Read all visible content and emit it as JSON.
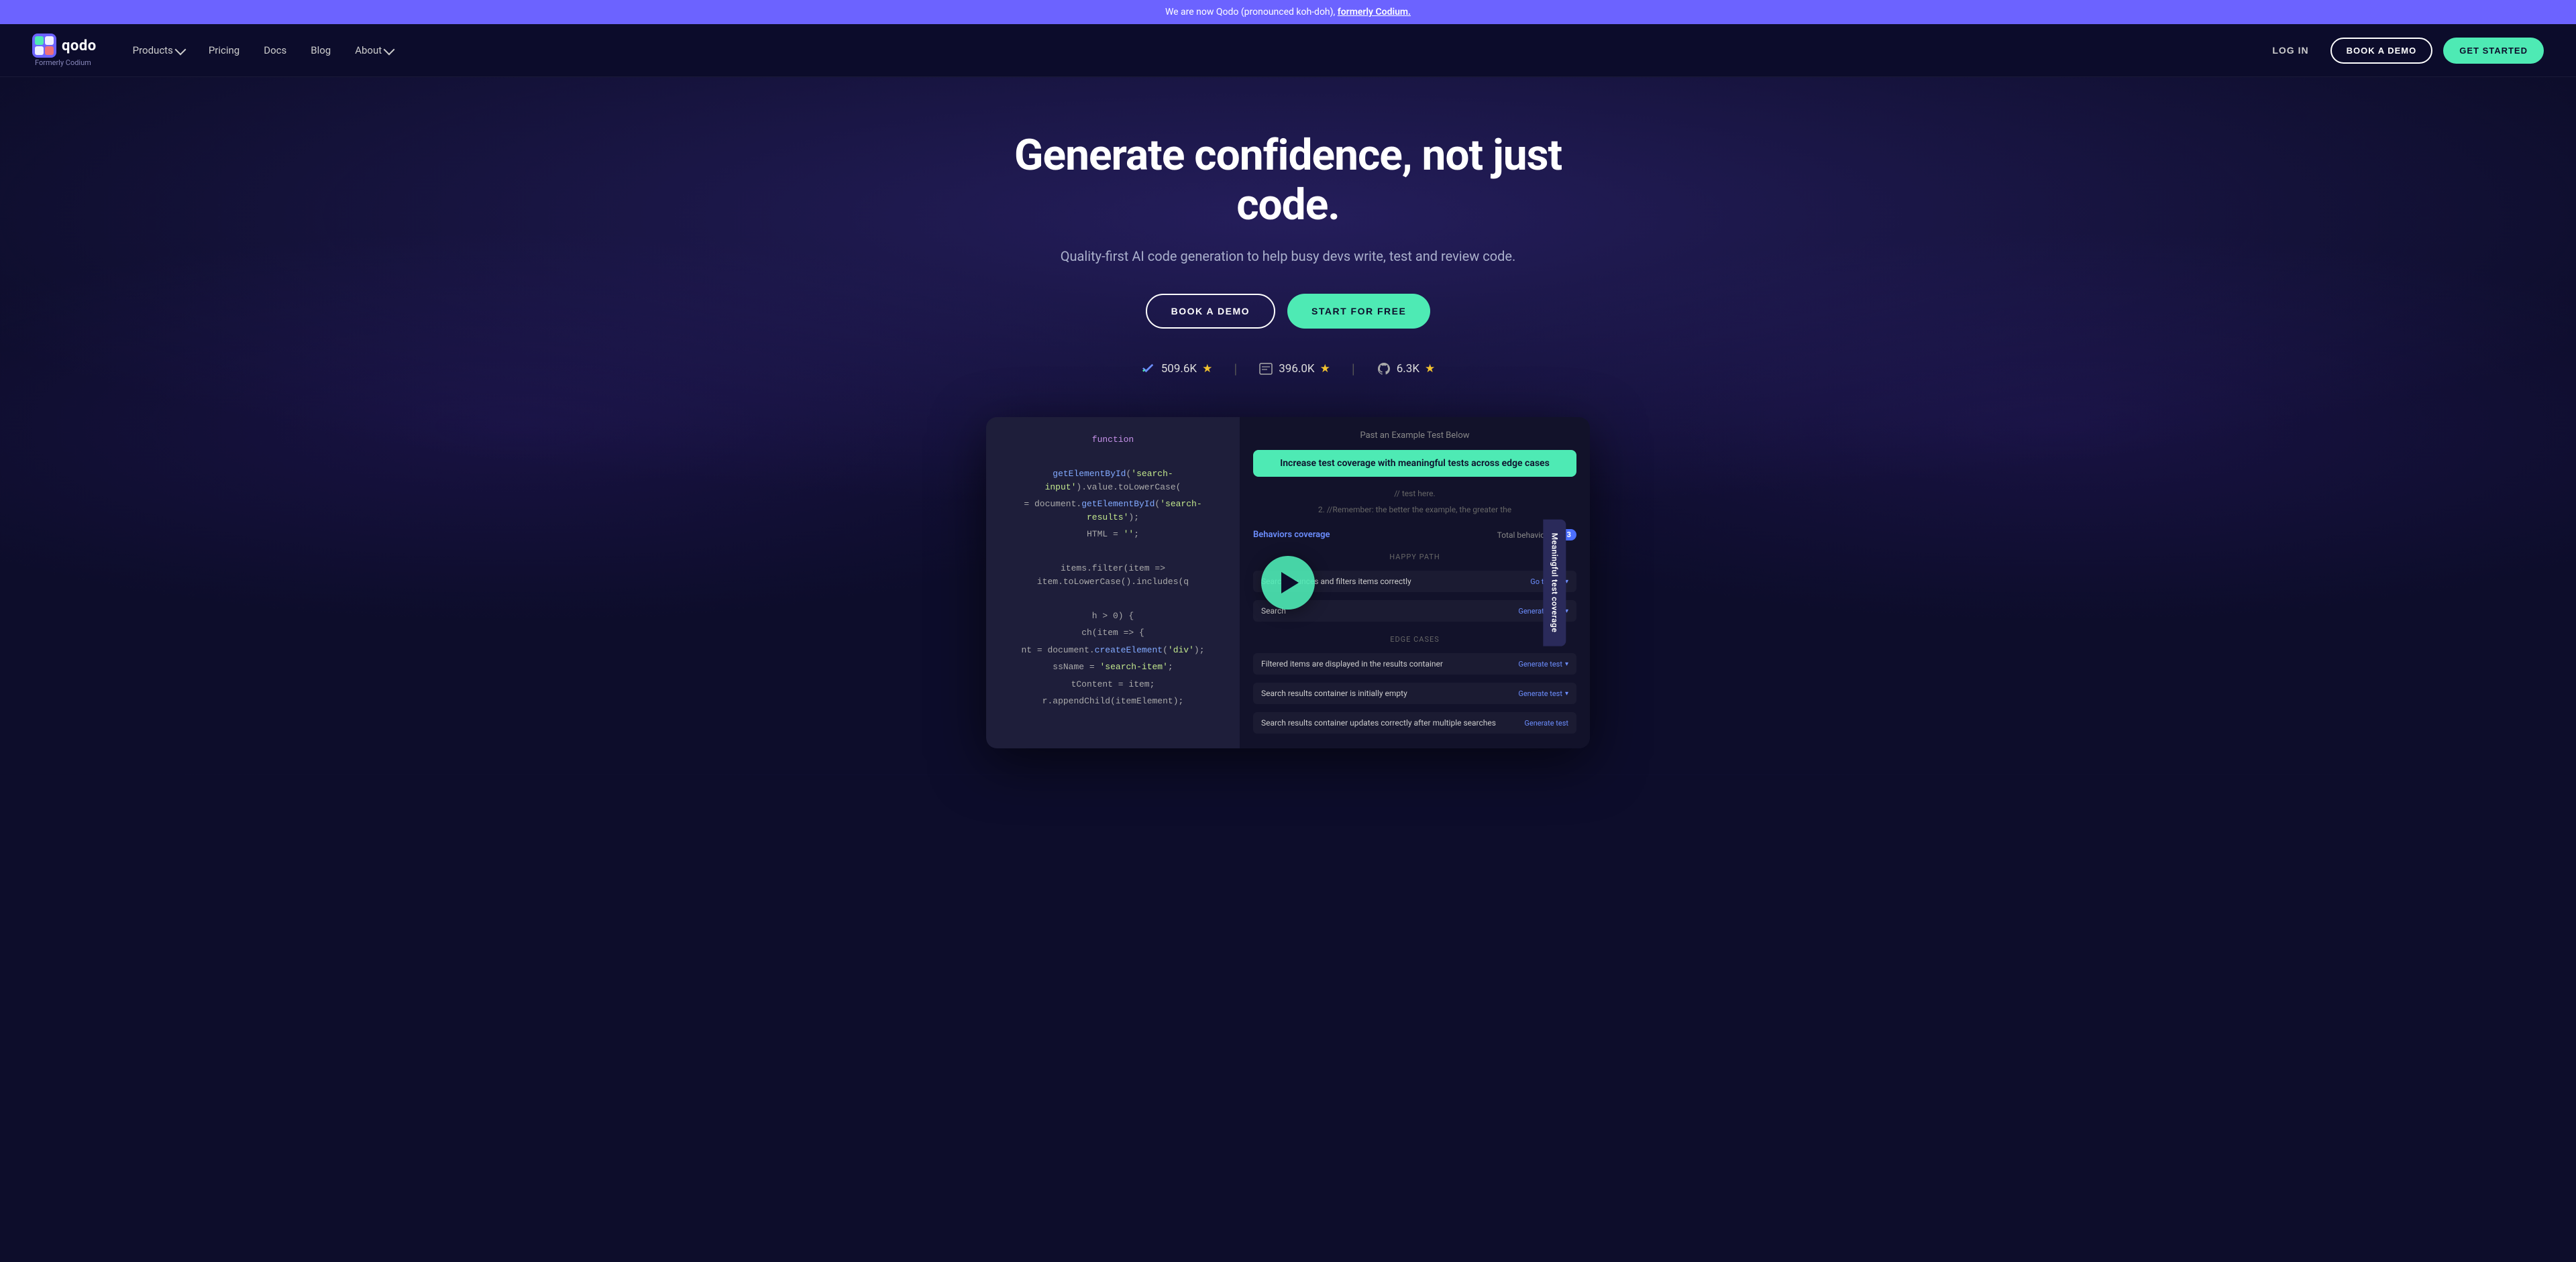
{
  "announcement": {
    "text": "We are now Qodo (pronounced koh-doh), ",
    "link_text": "formerly Codium.",
    "link_href": "#"
  },
  "nav": {
    "logo_text": "qodo",
    "formerly_text": "Formerly Codium",
    "links": [
      {
        "label": "Products",
        "has_dropdown": true
      },
      {
        "label": "Pricing",
        "has_dropdown": false
      },
      {
        "label": "Docs",
        "has_dropdown": false
      },
      {
        "label": "Blog",
        "has_dropdown": false
      },
      {
        "label": "About",
        "has_dropdown": true
      }
    ],
    "login_label": "LOG IN",
    "book_demo_label": "BOOK A DEMO",
    "get_started_label": "GET STARTED"
  },
  "hero": {
    "title": "Generate confidence, not just code.",
    "subtitle": "Quality-first AI code generation to help busy devs write, test and review code.",
    "book_demo_label": "BOOK A DEMO",
    "start_free_label": "START FOR FREE"
  },
  "stats": [
    {
      "icon": "vscode-icon",
      "value": "509.6K",
      "has_star": true
    },
    {
      "icon": "editor-icon",
      "value": "396.0K",
      "has_star": true
    },
    {
      "icon": "github-icon",
      "value": "6.3K",
      "has_star": true
    }
  ],
  "demo": {
    "header_text": "Past an Example Test Below",
    "green_bar_text": "Increase test coverage with meaningful tests across edge cases",
    "instructions": [
      "// test here.",
      "2. //Remember: the better the example, the greater the"
    ],
    "behaviors_label": "Behaviors coverage",
    "total_label": "Total behaviors",
    "total_count": "13",
    "happy_path_label": "HAPPY PATH",
    "happy_path_tests": [
      {
        "text": "Search bounces and filters items correctly",
        "action": "Go to test"
      },
      {
        "text": "Search",
        "action": "Generate test"
      }
    ],
    "edge_case_label": "EDGE CASES",
    "edge_tests": [
      {
        "text": "Filtered items are displayed in the results container",
        "action": "Generate test"
      },
      {
        "text": "Search results container is initially empty",
        "action": "Generate test"
      },
      {
        "text": "Search results container updates correctly after multiple searches",
        "action": "Generate test"
      }
    ],
    "side_tab_text": "Meaningful test coverage",
    "code_lines": [
      "function",
      "",
      "getElementById('search-input').value.toLowerCase(",
      "= document.getElementById('search-results');",
      "HTML = '';",
      "",
      "items.filter(item => item.toLowerCase().includes(q",
      "",
      "h > 0) {",
      "ch(item => {",
      "nt = document.createElement('div');",
      "ssName = 'search-item';",
      "tContent = item;",
      "r.appendChild(itemElement);"
    ]
  }
}
